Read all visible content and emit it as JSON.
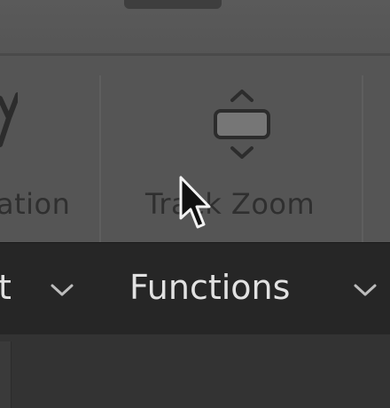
{
  "toolbar": {
    "tools": [
      {
        "label": "ation",
        "icon": "rotation-icon"
      },
      {
        "label": "Track Zoom",
        "icon": "track-zoom-icon"
      }
    ]
  },
  "functions_bar": {
    "items": [
      {
        "label": "t",
        "icon": "chevron-down-icon"
      },
      {
        "label": "Functions",
        "icon": "chevron-down-icon"
      }
    ]
  },
  "cursor": "arrow-cursor-icon"
}
